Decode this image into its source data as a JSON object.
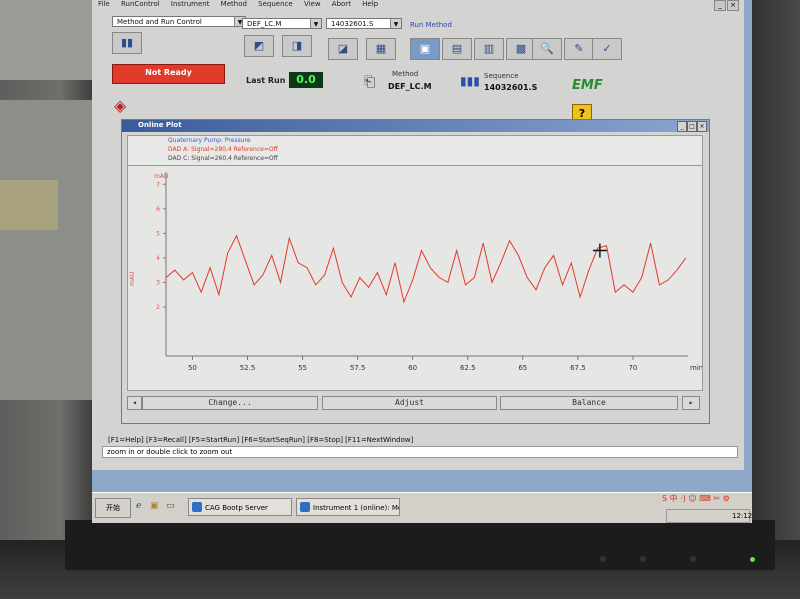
{
  "menu": [
    "File",
    "RunControl",
    "Instrument",
    "Method",
    "Sequence",
    "View",
    "Abort",
    "Help"
  ],
  "toolbar": {
    "view_combo": "Method and Run Control",
    "method_combo": "DEF_LC.M",
    "sequence_combo": "14032601.S",
    "run_method_label": "Run Method"
  },
  "status": {
    "state": "Not Ready",
    "last_run_label": "Last Run",
    "last_run_value": "0.0",
    "method_label": "Method",
    "method_value": "DEF_LC.M",
    "sequence_label": "Sequence",
    "sequence_value": "14032601.S",
    "logo": "EMF",
    "help": "?"
  },
  "plot_window": {
    "title": "Online Plot",
    "legend": [
      {
        "text": "Quaternary Pump: Pressure",
        "color": "#3a56c8"
      },
      {
        "text": "DAD A: Signal=280,4  Reference=Off",
        "color": "#e23a2a"
      },
      {
        "text": "DAD C: Signal=260,4  Reference=Off",
        "color": "#444444"
      }
    ],
    "buttons": {
      "change": "Change...",
      "adjust": "Adjust",
      "balance": "Balance"
    }
  },
  "chart_data": {
    "type": "line",
    "xlabel": "min",
    "ylabel": "mAU",
    "xlim": [
      48.8,
      72.5
    ],
    "ylim": [
      0,
      7.5
    ],
    "x_ticks": [
      "50",
      "52.5",
      "55",
      "57.5",
      "60",
      "62.5",
      "65",
      "67.5",
      "70"
    ],
    "y_ticks": [
      "7",
      "6",
      "5",
      "4",
      "3",
      "2"
    ],
    "grid": false,
    "series": [
      {
        "color": "#e23a2a",
        "x": [
          48.8,
          49.2,
          49.6,
          50.0,
          50.4,
          50.8,
          51.2,
          51.6,
          52.0,
          52.4,
          52.8,
          53.2,
          53.6,
          54.0,
          54.4,
          54.8,
          55.2,
          55.6,
          56.0,
          56.4,
          56.8,
          57.2,
          57.6,
          58.0,
          58.4,
          58.8,
          59.2,
          59.6,
          60.0,
          60.4,
          60.8,
          61.2,
          61.6,
          62.0,
          62.4,
          62.8,
          63.2,
          63.6,
          64.0,
          64.4,
          64.8,
          65.2,
          65.6,
          66.0,
          66.4,
          66.8,
          67.2,
          67.6,
          68.0,
          68.4,
          68.8,
          69.2,
          69.6,
          70.0,
          70.4,
          70.8,
          71.2,
          71.6,
          72.0,
          72.4
        ],
        "y": [
          3.2,
          3.5,
          3.1,
          3.4,
          2.6,
          3.6,
          2.5,
          4.2,
          4.9,
          3.9,
          2.9,
          3.3,
          4.1,
          3.0,
          4.8,
          3.8,
          3.6,
          2.9,
          3.3,
          4.4,
          3.0,
          2.4,
          3.2,
          2.8,
          3.4,
          2.5,
          3.8,
          2.2,
          3.1,
          4.3,
          3.6,
          3.2,
          3.0,
          4.3,
          2.9,
          3.2,
          4.6,
          3.0,
          3.8,
          4.7,
          4.1,
          3.2,
          2.7,
          3.6,
          4.1,
          2.9,
          3.8,
          2.4,
          3.5,
          4.4,
          4.5,
          2.6,
          2.9,
          2.6,
          3.2,
          4.6,
          2.9,
          3.1,
          3.5,
          4.0
        ]
      }
    ]
  },
  "function_keys": "[F1=Help]  [F3=Recall]  [F5=StartRun]  [F6=StartSeqRun]  [F8=Stop]  [F11=NextWindow]",
  "status_hint": "zoom in or double click to zoom out",
  "taskbar": {
    "start": "开始",
    "tasks": [
      "CAG Bootp Server",
      "Instrument 1 (online): Me..."
    ],
    "ime": "S 中 ·) ☺ ⌨ ✂ ⚙",
    "clock": "12:12"
  }
}
